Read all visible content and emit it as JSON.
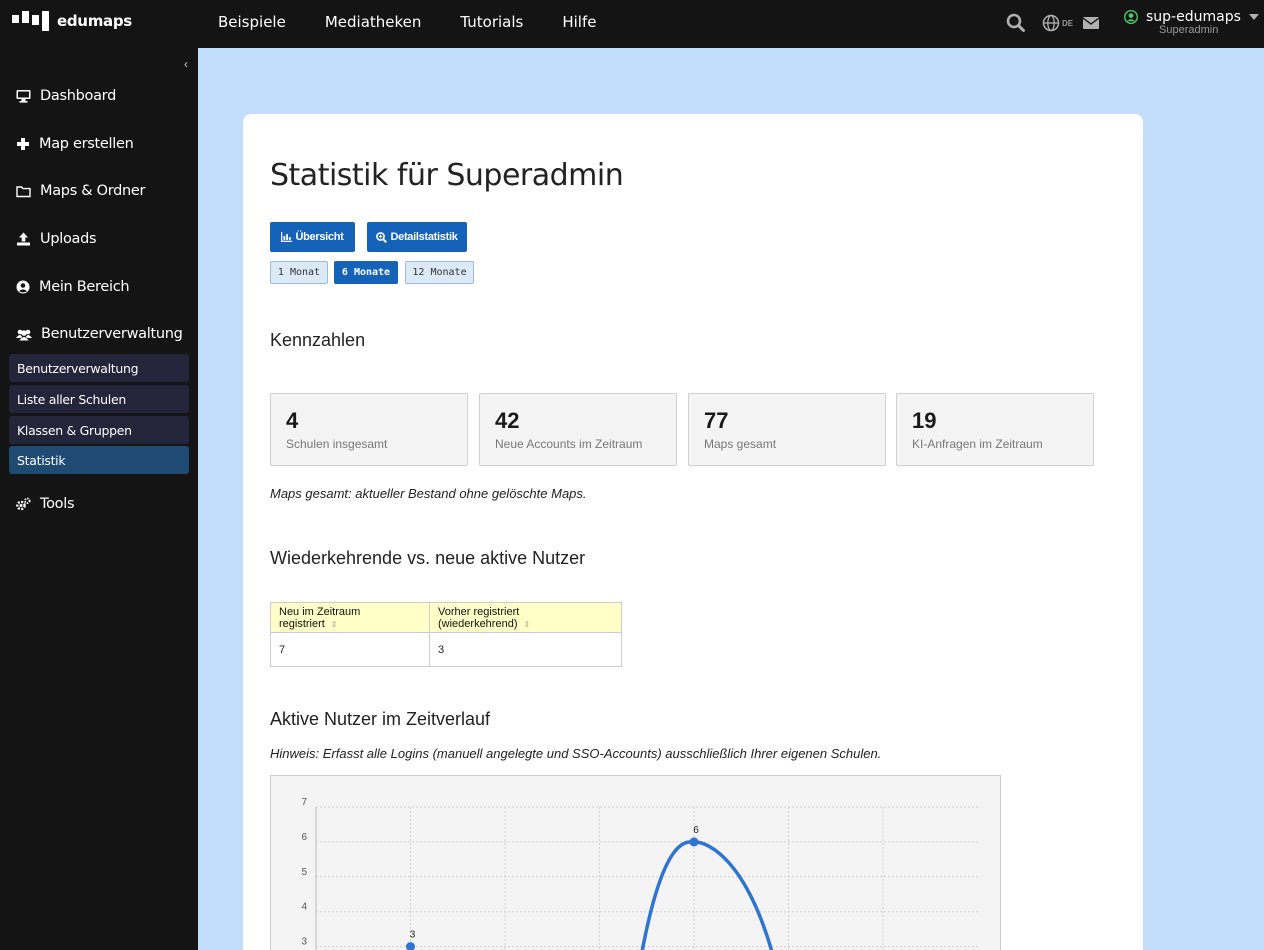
{
  "brand": {
    "name": "edumaps"
  },
  "nav": {
    "items": [
      "Beispiele",
      "Mediatheken",
      "Tutorials",
      "Hilfe"
    ]
  },
  "topbar": {
    "lang": "DE",
    "user_name": "sup-edumaps",
    "user_role": "Superadmin"
  },
  "sidebar": {
    "items": [
      {
        "label": "Dashboard",
        "icon": "monitor-icon"
      },
      {
        "label": "Map erstellen",
        "icon": "plus-icon"
      },
      {
        "label": "Maps & Ordner",
        "icon": "folder-icon"
      },
      {
        "label": "Uploads",
        "icon": "upload-icon"
      },
      {
        "label": "Mein Bereich",
        "icon": "user-circle-icon"
      },
      {
        "label": "Benutzerverwaltung",
        "icon": "users-icon"
      }
    ],
    "submenu": [
      "Benutzerverwaltung",
      "Liste aller Schulen",
      "Klassen & Gruppen",
      "Statistik"
    ],
    "active_submenu": "Statistik",
    "tools": {
      "label": "Tools",
      "icon": "cogs-icon"
    }
  },
  "page": {
    "title": "Statistik für Superadmin",
    "buttons": {
      "overview": "Übersicht",
      "details": "Detailstatistik"
    },
    "periods": [
      "1 Monat",
      "6 Monate",
      "12 Monate"
    ],
    "active_period": "6 Monate"
  },
  "kennzahlen": {
    "title": "Kennzahlen",
    "cards": [
      {
        "value": "4",
        "label": "Schulen insgesamt"
      },
      {
        "value": "42",
        "label": "Neue Accounts im Zeitraum"
      },
      {
        "value": "77",
        "label": "Maps gesamt"
      },
      {
        "value": "19",
        "label": "KI-Anfragen im Zeitraum"
      }
    ],
    "note": "Maps gesamt: aktueller Bestand ohne gelöschte Maps."
  },
  "returning": {
    "title": "Wiederkehrende vs. neue aktive Nutzer",
    "headers": [
      "Neu im Zeitraum registriert",
      "Vorher registriert (wiederkehrend)"
    ],
    "values": [
      "7",
      "3"
    ]
  },
  "active_users": {
    "title": "Aktive Nutzer im Zeitverlauf",
    "note": "Hinweis: Erfasst alle Logins (manuell angelegte und SSO-Accounts) ausschließlich Ihrer eigenen Schulen."
  },
  "colors": {
    "accent": "#1563b8",
    "series": "#2f74d0",
    "background": "#c3defa"
  },
  "chart_data": {
    "type": "line",
    "x": [
      0,
      1,
      2,
      3,
      4,
      5,
      6
    ],
    "series": [
      {
        "values": [
          null,
          3,
          null,
          null,
          6,
          null,
          null
        ]
      }
    ],
    "data_labels": [
      "3",
      "6"
    ],
    "y_ticks": [
      "3",
      "4",
      "5",
      "6",
      "7"
    ],
    "xlabel": "",
    "ylabel": "",
    "ylim": [
      0,
      7
    ],
    "grid": true
  }
}
